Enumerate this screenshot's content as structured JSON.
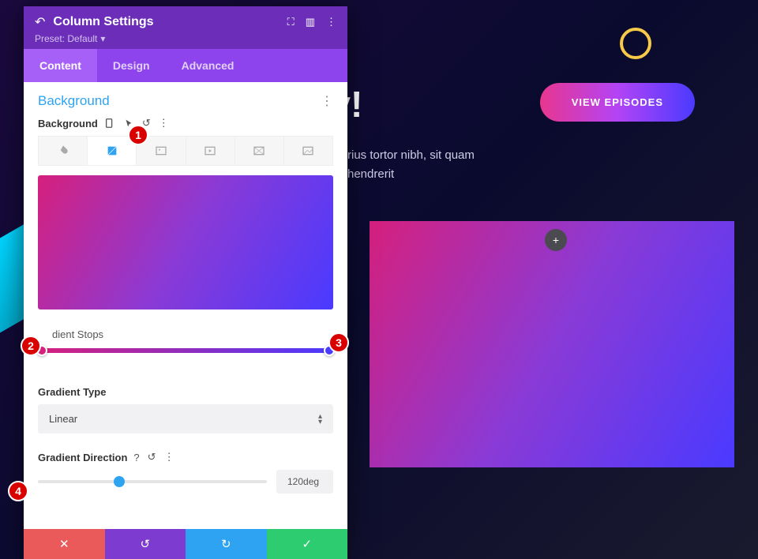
{
  "hero": {
    "title_fragment": "lay!",
    "text": "rius tortor nibh, sit quam hendrerit",
    "button": "VIEW EPISODES"
  },
  "panel": {
    "title": "Column Settings",
    "preset_label": "Preset: Default",
    "tabs": {
      "content": "Content",
      "design": "Design",
      "advanced": "Advanced"
    },
    "section": "Background",
    "bg_field_label": "Background",
    "stops_label": "dient Stops",
    "gradient_type_label": "Gradient Type",
    "gradient_type_value": "Linear",
    "direction_label": "Gradient Direction",
    "direction_value": "120deg"
  },
  "annotations": {
    "a1": "1",
    "a2": "2",
    "a3": "3",
    "a4": "4"
  },
  "icons": {
    "plus": "+",
    "close": "✕",
    "check": "✓",
    "undo": "↺",
    "redo": "↻",
    "dots_v": "⋮",
    "caret": "▾",
    "up": "▴",
    "down": "▾",
    "help": "?"
  }
}
